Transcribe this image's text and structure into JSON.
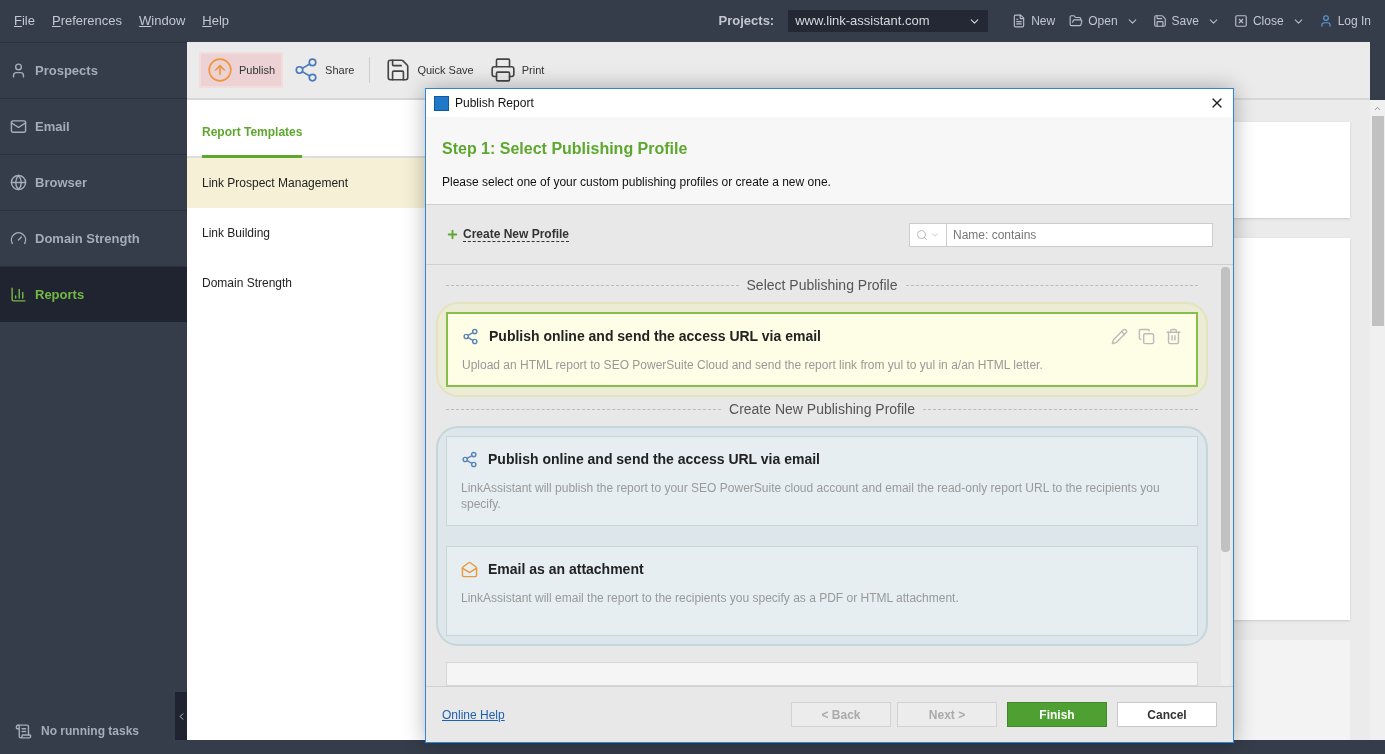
{
  "menu": [
    "File",
    "Preferences",
    "Window",
    "Help"
  ],
  "projects": {
    "label": "Projects:",
    "value": "www.link-assistant.com"
  },
  "top_actions": [
    {
      "label": "New",
      "kind": "new",
      "dropdown": false
    },
    {
      "label": "Open",
      "kind": "open",
      "dropdown": true
    },
    {
      "label": "Save",
      "kind": "save",
      "dropdown": true
    },
    {
      "label": "Close",
      "kind": "close",
      "dropdown": true
    },
    {
      "label": "Log In",
      "kind": "login",
      "dropdown": false
    }
  ],
  "sidebar": {
    "items": [
      {
        "label": "Prospects",
        "kind": "person",
        "selected": false
      },
      {
        "label": "Email",
        "kind": "mail",
        "selected": false
      },
      {
        "label": "Browser",
        "kind": "globe",
        "selected": false
      },
      {
        "label": "Domain Strength",
        "kind": "gauge",
        "selected": false
      },
      {
        "label": "Reports",
        "kind": "report",
        "selected": true
      }
    ],
    "status": "No running tasks"
  },
  "toolbar": [
    {
      "label": "Publish",
      "kind": "publish",
      "selected": true
    },
    {
      "label": "Share",
      "kind": "share",
      "selected": false
    },
    {
      "label": "Quick Save",
      "kind": "save",
      "selected": false
    },
    {
      "label": "Print",
      "kind": "print",
      "selected": false
    }
  ],
  "templates": {
    "tab": "Report Templates",
    "items": [
      {
        "label": "Link Prospect Management",
        "selected": true
      },
      {
        "label": "Link Building",
        "selected": false
      },
      {
        "label": "Domain Strength",
        "selected": false
      }
    ]
  },
  "dialog": {
    "title": "Publish Report",
    "step": "Step 1: Select Publishing Profile",
    "description": "Please select one of your custom publishing profiles or create a new one.",
    "create_link": "Create New Profile",
    "search": {
      "placeholder": "Name: contains"
    },
    "sections": [
      {
        "heading": "Select Publishing Profile",
        "kind": "custom",
        "profiles": [
          {
            "title": "Publish online and send the access URL via email",
            "description": "Upload an HTML report to SEO PowerSuite Cloud and send the report link from yul  to yul  in a/an HTML letter.",
            "kind": "share",
            "selected": true
          }
        ]
      },
      {
        "heading": "Create New Publishing Profile",
        "kind": "new",
        "profiles": [
          {
            "title": "Publish online and send the access URL via email",
            "description": "LinkAssistant will publish the report to your SEO PowerSuite cloud account and email the read-only report URL to the recipients you specify.",
            "kind": "share",
            "selected": false
          },
          {
            "title": "Email as an attachment",
            "description": "LinkAssistant will email the report to the recipients you specify as a PDF or HTML attachment.",
            "kind": "mail",
            "selected": false
          }
        ]
      }
    ],
    "help_link": "Online Help",
    "buttons": [
      {
        "label": "< Back",
        "disabled": true,
        "primary": false
      },
      {
        "label": "Next >",
        "disabled": true,
        "primary": false
      },
      {
        "label": "Finish",
        "disabled": false,
        "primary": true
      },
      {
        "label": "Cancel",
        "disabled": false,
        "primary": false
      }
    ]
  }
}
